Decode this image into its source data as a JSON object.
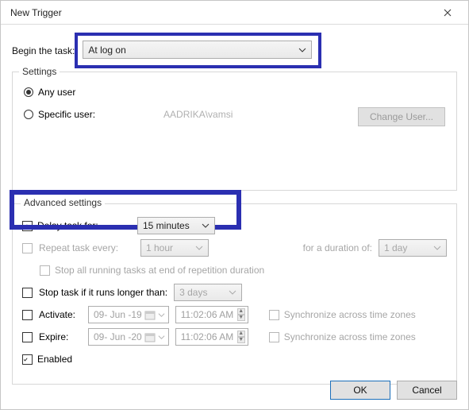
{
  "window": {
    "title": "New Trigger"
  },
  "begin": {
    "label": "Begin the task:",
    "value": "At log on"
  },
  "settings_group": {
    "legend": "Settings",
    "any_user": "Any user",
    "specific_user": "Specific user:",
    "specific_user_value": "AADRIKA\\vamsi",
    "change_user_btn": "Change User..."
  },
  "advanced": {
    "legend": "Advanced settings",
    "delay": {
      "label": "Delay task for:",
      "value": "15 minutes",
      "checked": true
    },
    "repeat": {
      "label": "Repeat task every:",
      "value": "1 hour",
      "duration_label": "for a duration of:",
      "duration_value": "1 day",
      "checked": false,
      "stop_all_label": "Stop all running tasks at end of repetition duration"
    },
    "stop_longer": {
      "label": "Stop task if it runs longer than:",
      "value": "3 days",
      "checked": false
    },
    "activate": {
      "label": "Activate:",
      "date": "09- Jun -19",
      "time": "11:02:06 AM",
      "checked": false,
      "sync": "Synchronize across time zones"
    },
    "expire": {
      "label": "Expire:",
      "date": "09- Jun -20",
      "time": "11:02:06 AM",
      "checked": false,
      "sync": "Synchronize across time zones"
    },
    "enabled": {
      "label": "Enabled",
      "checked": true
    }
  },
  "buttons": {
    "ok": "OK",
    "cancel": "Cancel"
  }
}
